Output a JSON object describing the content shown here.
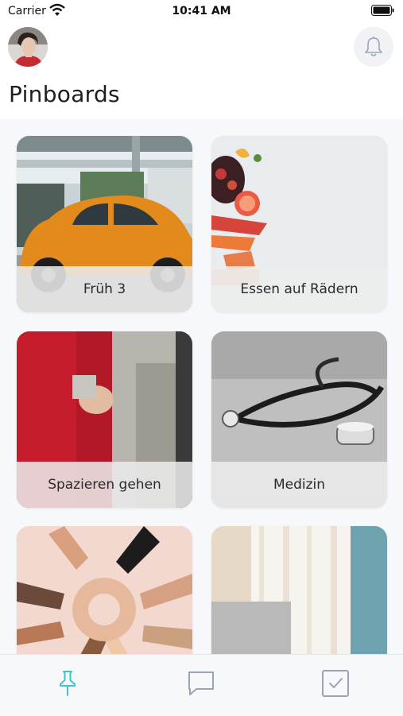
{
  "status_bar": {
    "carrier": "Carrier",
    "time": "10:41 AM"
  },
  "header": {
    "title": "Pinboards",
    "avatar_icon": "user-avatar",
    "notification_icon": "bell-icon"
  },
  "pinboards": [
    {
      "label": "Früh 3",
      "image": "orange-beetle-car"
    },
    {
      "label": "Essen auf Rädern",
      "image": "fruit-food"
    },
    {
      "label": "Spazieren gehen",
      "image": "walking-arm-in-arm"
    },
    {
      "label": "Medizin",
      "image": "stethoscope"
    },
    {
      "label": "",
      "image": "hands-circle"
    },
    {
      "label": "",
      "image": "curtain-window"
    }
  ],
  "tab_bar": {
    "items": [
      {
        "icon": "pin-icon",
        "active": true
      },
      {
        "icon": "chat-icon",
        "active": false
      },
      {
        "icon": "checkbox-icon",
        "active": false
      }
    ]
  },
  "colors": {
    "accent": "#3cc3d6",
    "inactive_icon": "#9aa4b5",
    "content_bg": "#f6f8fb"
  }
}
